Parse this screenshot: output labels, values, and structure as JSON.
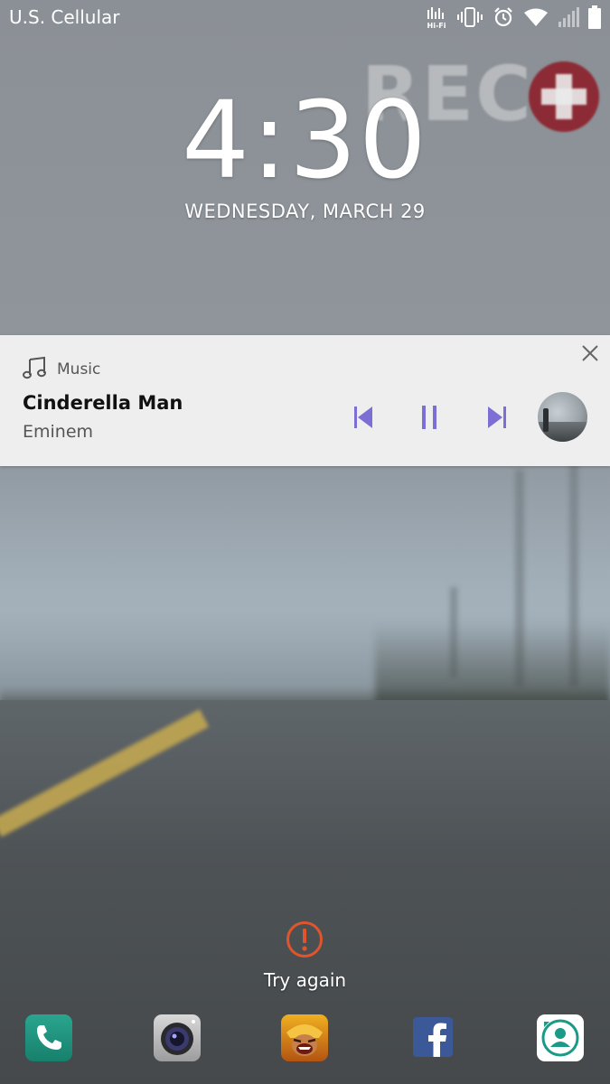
{
  "status_bar": {
    "carrier": "U.S. Cellular",
    "hifi_line1": "Hi-Fi"
  },
  "lock_screen": {
    "time": "4:30",
    "date": "WEDNESDAY, MARCH 29"
  },
  "music_notification": {
    "app_label": "Music",
    "song_title": "Cinderella Man",
    "artist": "Eminem",
    "accent_color": "#7b6fd6"
  },
  "retry": {
    "label": "Try again",
    "icon_color": "#e0552b"
  },
  "dock": {
    "apps": [
      "phone-app",
      "camera-app",
      "clash-of-clans-app",
      "facebook-app",
      "contacts-app"
    ]
  }
}
